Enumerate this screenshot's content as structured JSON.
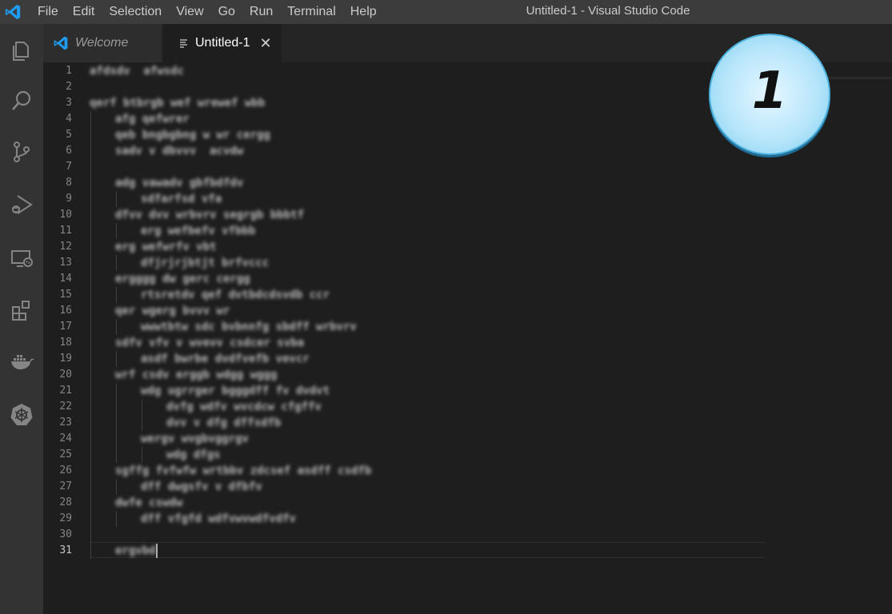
{
  "titlebar": {
    "menu": [
      "File",
      "Edit",
      "Selection",
      "View",
      "Go",
      "Run",
      "Terminal",
      "Help"
    ],
    "window_title": "Untitled-1 - Visual Studio Code"
  },
  "activitybar": {
    "icons": [
      "explorer-icon",
      "search-icon",
      "source-control-icon",
      "run-debug-icon",
      "remote-explorer-icon",
      "extensions-icon",
      "docker-icon",
      "kubernetes-icon"
    ]
  },
  "tabs": [
    {
      "label": "Welcome",
      "active": false,
      "icon": "vscode-logo-icon"
    },
    {
      "label": "Untitled-1",
      "active": true,
      "icon": "file-lines-icon",
      "close": "✕"
    }
  ],
  "editor": {
    "line_numbers": [
      "1",
      "2",
      "3",
      "4",
      "5",
      "6",
      "7",
      "8",
      "9",
      "10",
      "11",
      "12",
      "13",
      "14",
      "15",
      "16",
      "17",
      "18",
      "19",
      "20",
      "21",
      "22",
      "23",
      "24",
      "25",
      "26",
      "27",
      "28",
      "29",
      "30",
      "31"
    ],
    "active_line": "31",
    "lines": [
      {
        "indent": 0,
        "text": "afdsdv  afwsdc"
      },
      {
        "indent": 0,
        "text": ""
      },
      {
        "indent": 0,
        "text": "qerf btbrgb wef wrewef wbb"
      },
      {
        "indent": 1,
        "text": "afg qefwrer"
      },
      {
        "indent": 1,
        "text": "qeb bngbgbng w wr cergg"
      },
      {
        "indent": 1,
        "text": "sadv v dbvvv  acvdw"
      },
      {
        "indent": 0,
        "text": ""
      },
      {
        "indent": 1,
        "text": "adg vawadv gbfbdfdv"
      },
      {
        "indent": 2,
        "text": "sdfarfsd vfa"
      },
      {
        "indent": 1,
        "text": "dfvv dvv wrbvrv segrgb bbbtf"
      },
      {
        "indent": 2,
        "text": "erg wefbefv vfbbb"
      },
      {
        "indent": 1,
        "text": "erg wefwrfv vbt"
      },
      {
        "indent": 2,
        "text": "dfjrjrjbtjt brfvccc"
      },
      {
        "indent": 1,
        "text": "ergggg dw gerc cergg"
      },
      {
        "indent": 2,
        "text": "rtsretdv qef dvtbdcdsvdb ccr"
      },
      {
        "indent": 1,
        "text": "qer wgerg bvvv wr"
      },
      {
        "indent": 2,
        "text": "wwwtbtw sdc bvbnnfg sbdff wrbvrv"
      },
      {
        "indent": 1,
        "text": "sdfv vfv v wvevv csdcer svba"
      },
      {
        "indent": 2,
        "text": "asdf bwrbe dvdfvefb vevcr"
      },
      {
        "indent": 1,
        "text": "wrf csdv erggb wdgg wggg"
      },
      {
        "indent": 2,
        "text": "wdg ugrrger bgggdff fv dvdvt"
      },
      {
        "indent": 3,
        "text": "dvfg wdfv wvcdcw cfgffv"
      },
      {
        "indent": 3,
        "text": "dvv v dfg dffsdfb"
      },
      {
        "indent": 2,
        "text": "wergv wvgbvggrgv"
      },
      {
        "indent": 3,
        "text": "wdg dfgs"
      },
      {
        "indent": 1,
        "text": "sgffg fvfwfw wrtbbv zdcsef asdff csdfb"
      },
      {
        "indent": 2,
        "text": "dff dwgsfv v dfbfv"
      },
      {
        "indent": 1,
        "text": "dwfe cswdw"
      },
      {
        "indent": 2,
        "text": "dff vfgfd wdfvwvwdfvdfv"
      },
      {
        "indent": 0,
        "text": ""
      },
      {
        "indent": 1,
        "text": "ergvbd"
      }
    ]
  },
  "badge": {
    "text": "1",
    "color": "#b8e6fb"
  },
  "colors": {
    "titlebar_bg": "#3c3c3c",
    "activitybar_bg": "#333333",
    "editor_bg": "#1e1e1e",
    "accent_logo": "#0098ff"
  }
}
